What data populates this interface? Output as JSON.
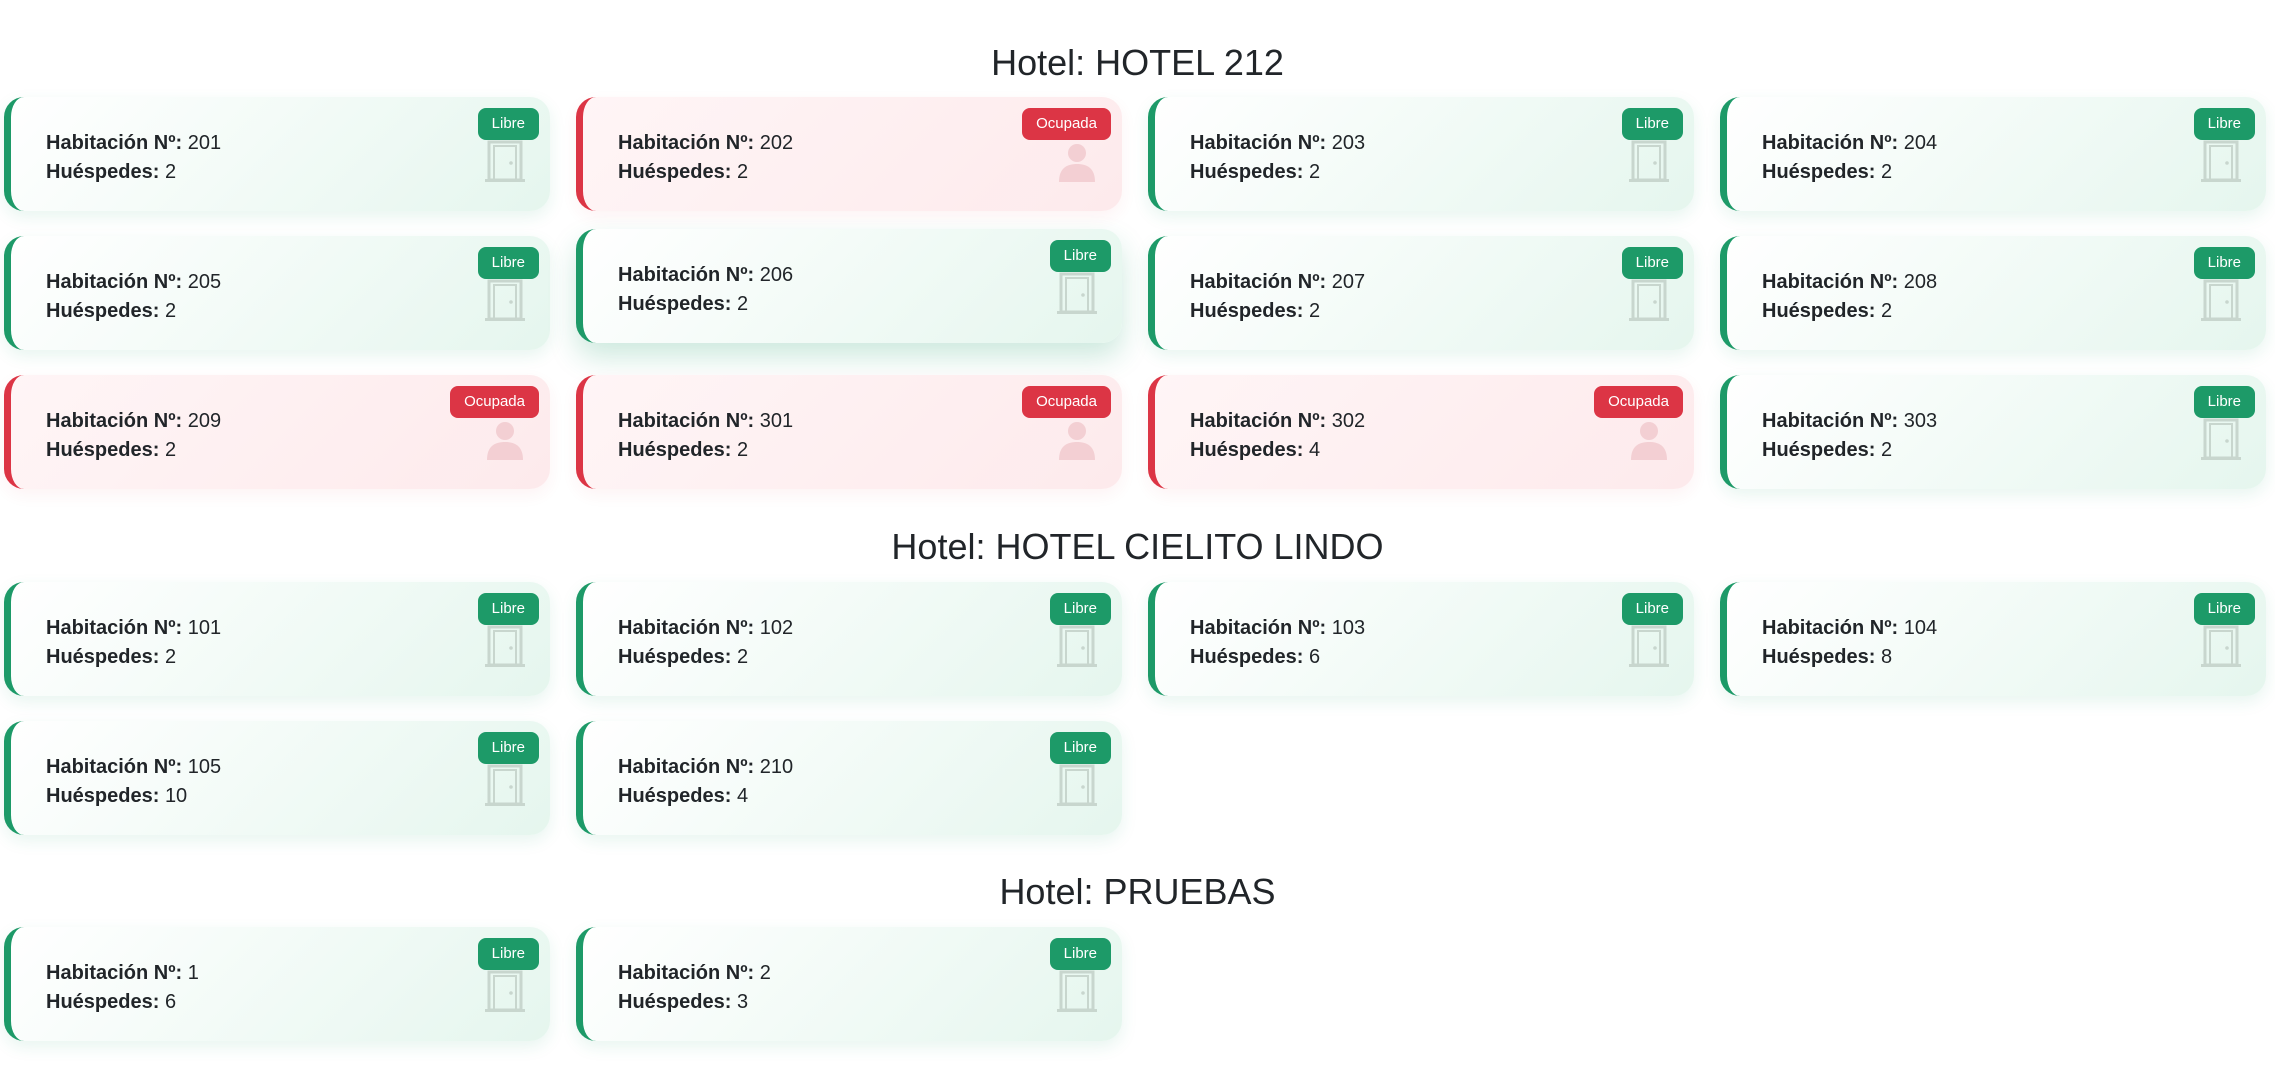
{
  "labels": {
    "room_number": "Habitación Nº:",
    "guests": "Huéspedes:"
  },
  "colors": {
    "libre": "#1d9a68",
    "ocupada": "#dc3545"
  },
  "hotels": [
    {
      "title": "Hotel: HOTEL 212",
      "rooms": [
        {
          "number": "201",
          "guests": "2",
          "status": "Libre",
          "icon": "door-icon"
        },
        {
          "number": "202",
          "guests": "2",
          "status": "Ocupada",
          "icon": "person-icon"
        },
        {
          "number": "203",
          "guests": "2",
          "status": "Libre",
          "icon": "door-icon"
        },
        {
          "number": "204",
          "guests": "2",
          "status": "Libre",
          "icon": "door-icon"
        },
        {
          "number": "205",
          "guests": "2",
          "status": "Libre",
          "icon": "door-icon"
        },
        {
          "number": "206",
          "guests": "2",
          "status": "Libre",
          "icon": "door-icon"
        },
        {
          "number": "207",
          "guests": "2",
          "status": "Libre",
          "icon": "door-icon"
        },
        {
          "number": "208",
          "guests": "2",
          "status": "Libre",
          "icon": "door-icon"
        },
        {
          "number": "209",
          "guests": "2",
          "status": "Ocupada",
          "icon": "person-icon"
        },
        {
          "number": "301",
          "guests": "2",
          "status": "Ocupada",
          "icon": "person-icon"
        },
        {
          "number": "302",
          "guests": "4",
          "status": "Ocupada",
          "icon": "person-icon"
        },
        {
          "number": "303",
          "guests": "2",
          "status": "Libre",
          "icon": "door-icon"
        }
      ]
    },
    {
      "title": "Hotel: HOTEL CIELITO LINDO",
      "rooms": [
        {
          "number": "101",
          "guests": "2",
          "status": "Libre",
          "icon": "door-icon"
        },
        {
          "number": "102",
          "guests": "2",
          "status": "Libre",
          "icon": "door-icon"
        },
        {
          "number": "103",
          "guests": "6",
          "status": "Libre",
          "icon": "door-icon"
        },
        {
          "number": "104",
          "guests": "8",
          "status": "Libre",
          "icon": "door-icon"
        },
        {
          "number": "105",
          "guests": "10",
          "status": "Libre",
          "icon": "door-icon"
        },
        {
          "number": "210",
          "guests": "4",
          "status": "Libre",
          "icon": "door-icon"
        }
      ]
    },
    {
      "title": "Hotel: PRUEBAS",
      "rooms": [
        {
          "number": "1",
          "guests": "6",
          "status": "Libre",
          "icon": "door-icon"
        },
        {
          "number": "2",
          "guests": "3",
          "status": "Libre",
          "icon": "door-icon"
        }
      ]
    }
  ]
}
